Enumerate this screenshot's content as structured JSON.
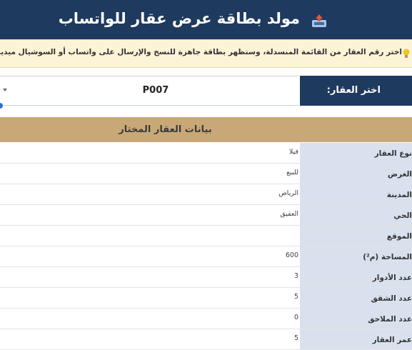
{
  "header": {
    "title": "مولد بطاقة عرض عقار للواتساب",
    "icon": "outbox-tray-icon",
    "background": "#1f3a5f"
  },
  "tip": {
    "icon": "light-bulb-icon",
    "text": "اختر رقم العقار من القائمة المنسدلة، وستظهر بطاقة جاهزة للنسخ والإرسال على واتساب أو السوشيال ميديا"
  },
  "selector": {
    "label": "اختر العقار:",
    "value": "P007"
  },
  "section": {
    "title": "بيانات العقار المختار",
    "background": "#c9a878"
  },
  "fields": [
    {
      "label": "نوع العقار",
      "value": "فيلا"
    },
    {
      "label": "الغرض",
      "value": "للبيع"
    },
    {
      "label": "المدينة",
      "value": "الرياض"
    },
    {
      "label": "الحي",
      "value": "العقيق"
    },
    {
      "label": "الموقع",
      "value": ""
    },
    {
      "label": "المساحة (م²)",
      "value": "600"
    },
    {
      "label": "عدد الأدوار",
      "value": "3"
    },
    {
      "label": "عدد الشقق",
      "value": "5"
    },
    {
      "label": "عدد الملاحق",
      "value": "0"
    },
    {
      "label": "عمر العقار",
      "value": "5"
    }
  ]
}
